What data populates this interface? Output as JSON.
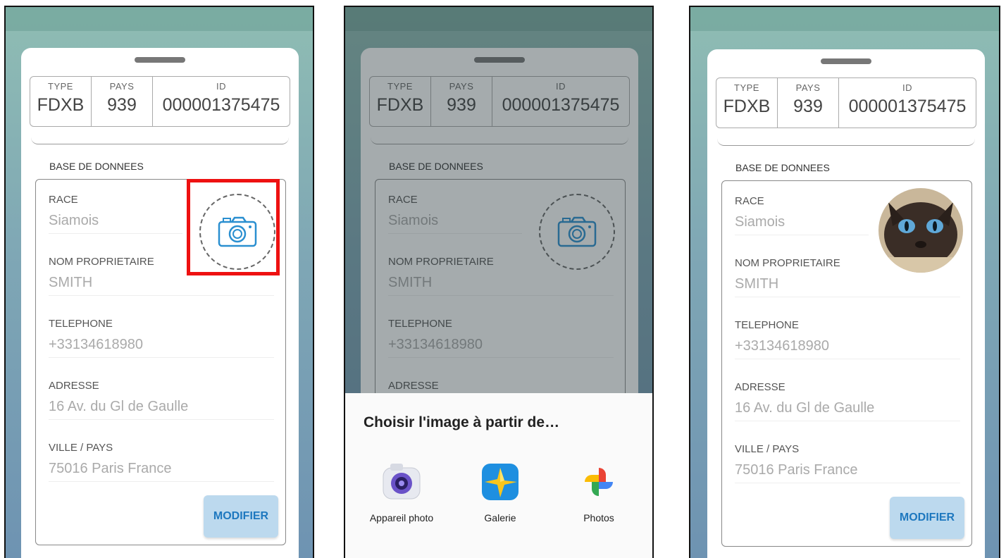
{
  "record": {
    "type_label": "TYPE",
    "type_value": "FDXB",
    "pays_label": "PAYS",
    "pays_value": "939",
    "id_label": "ID",
    "id_value": "000001375475"
  },
  "section_label": "BASE DE DONNEES",
  "fields": [
    {
      "label": "RACE",
      "value": "Siamois"
    },
    {
      "label": "NOM PROPRIETAIRE",
      "value": "SMITH"
    },
    {
      "label": "TELEPHONE",
      "value": "+33134618980"
    },
    {
      "label": "ADRESSE",
      "value": "16 Av. du Gl  de  Gaulle"
    },
    {
      "label": "VILLE / PAYS",
      "value": "75016 Paris France"
    }
  ],
  "modify_label": "MODIFIER",
  "chooser": {
    "title": "Choisir l'image à partir de…",
    "apps": [
      {
        "label": "Appareil photo",
        "icon": "camera-app-icon"
      },
      {
        "label": "Galerie",
        "icon": "gallery-app-icon"
      },
      {
        "label": "Photos",
        "icon": "photos-app-icon"
      }
    ]
  },
  "colors": {
    "highlight": "#ee1111",
    "accent": "#1e78bf",
    "button_bg": "#bcd9ee"
  }
}
